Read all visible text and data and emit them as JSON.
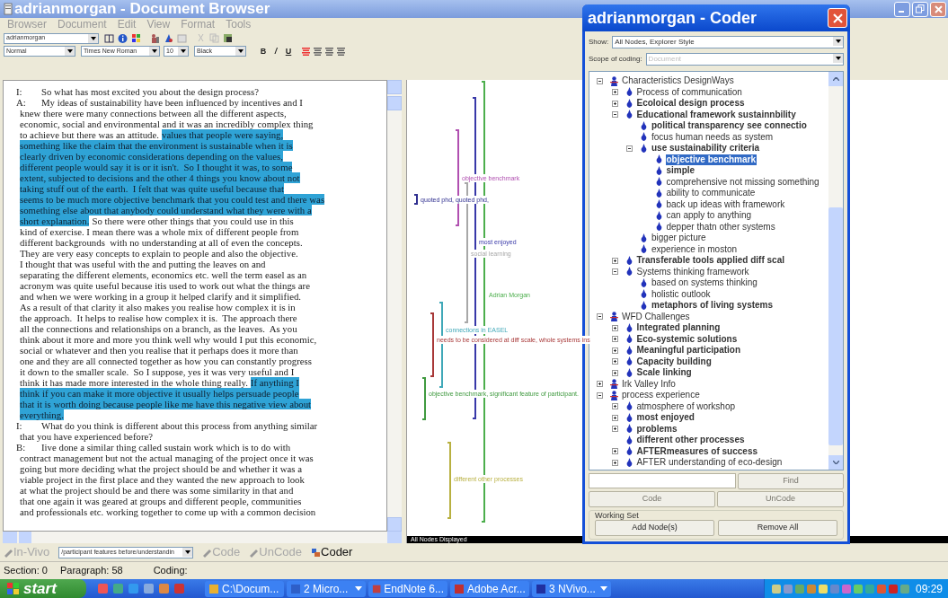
{
  "window": {
    "title": "adrianmorgan - Document Browser"
  },
  "menu": [
    "Browser",
    "Document",
    "Edit",
    "View",
    "Format",
    "Tools"
  ],
  "toolbar": {
    "user": "adrianmorgan"
  },
  "format_bar": {
    "style": "Normal",
    "font": "Times New Roman",
    "size": "10",
    "text_color": "Black",
    "buttons": [
      "B",
      "/",
      "U"
    ]
  },
  "document": {
    "lines": [
      {
        "speaker": "I:",
        "segments": [
          {
            "text": "So what has most excited you about the design process?",
            "coded": false
          }
        ]
      },
      {
        "speaker": "A:",
        "segments": [
          {
            "text": "My ideas of sustainability have been influenced by incentives and I",
            "coded": false
          }
        ]
      },
      {
        "segments": [
          {
            "text": "knew there were many connections between all the different aspects,",
            "coded": false
          }
        ]
      },
      {
        "segments": [
          {
            "text": "economic, social and environmental and it was an incredibly complex thing",
            "coded": false
          }
        ]
      },
      {
        "segments": [
          {
            "text": "to achieve but there was an attitude.",
            "coded": false
          },
          {
            "text": "values that people were saying,",
            "coded": true
          }
        ]
      },
      {
        "segments": [
          {
            "text": "something like the claim that the environment is sustainable when it is",
            "coded": true
          }
        ]
      },
      {
        "segments": [
          {
            "text": "clearly driven by economic considerations depending on the values,",
            "coded": true
          }
        ]
      },
      {
        "segments": [
          {
            "text": "different people would say it is or it isn't.  So I thought it was, to some",
            "coded": true
          }
        ]
      },
      {
        "segments": [
          {
            "text": "extent, subjected to decisions and the other 4 things you know about not",
            "coded": true
          }
        ]
      },
      {
        "segments": [
          {
            "text": "taking stuff out of the earth.  I felt that was quite useful because that",
            "coded": true
          }
        ]
      },
      {
        "segments": [
          {
            "text": "seems to be much more objective benchmark that you could test and there was",
            "coded": true
          }
        ]
      },
      {
        "segments": [
          {
            "text": "something else about that anybody could understand what they were with a",
            "coded": true
          }
        ]
      },
      {
        "segments": [
          {
            "text": "short explanation.",
            "coded": true
          },
          {
            "text": "So there were other things that you could use in this",
            "coded": false
          }
        ]
      },
      {
        "segments": [
          {
            "text": "kind of exercise. I mean there was a whole mix of different people from",
            "coded": false
          }
        ]
      },
      {
        "segments": [
          {
            "text": "different backgrounds  with no understanding at all of even the concepts.",
            "coded": false
          }
        ]
      },
      {
        "segments": [
          {
            "text": "They are very easy concepts to explain to people and also the objective.",
            "coded": false
          }
        ]
      },
      {
        "segments": [
          {
            "text": "I thought that was useful with the and putting the leaves on and",
            "coded": false
          }
        ]
      },
      {
        "segments": [
          {
            "text": "separating the different elements, economics etc. well the term easel as an",
            "coded": false
          }
        ]
      },
      {
        "segments": [
          {
            "text": "acronym was quite useful because itis used to work out what the things are",
            "coded": false
          }
        ]
      },
      {
        "segments": [
          {
            "text": "and when we were working in a group it helped clarify and it simplified.",
            "coded": false
          }
        ]
      },
      {
        "segments": [
          {
            "text": "As a result of that clarity it also makes you realise how complex it is in",
            "coded": false
          }
        ]
      },
      {
        "segments": [
          {
            "text": "the approach.  It helps to realise how complex it is.  The approach there",
            "coded": false
          }
        ]
      },
      {
        "segments": [
          {
            "text": "all the connections and relationships on a branch, as the leaves.  As you",
            "coded": false
          }
        ]
      },
      {
        "segments": [
          {
            "text": "think about it more and more you think well why would I put this economic,",
            "coded": false
          }
        ]
      },
      {
        "segments": [
          {
            "text": "social or whatever and then you realise that it perhaps does it more than",
            "coded": false
          }
        ]
      },
      {
        "segments": [
          {
            "text": "one and they are all connected together as how you can constantly progress",
            "coded": false
          }
        ]
      },
      {
        "segments": [
          {
            "text": "it down to the smaller scale.  So I suppose, yes it was very useful and I",
            "coded": false
          }
        ]
      },
      {
        "segments": [
          {
            "text": "think it has made more interested in the whole thing really.",
            "coded": false
          },
          {
            "text": "If anything I",
            "coded": true
          }
        ]
      },
      {
        "segments": [
          {
            "text": "think if you can make it more objective it usually helps persuade people",
            "coded": true
          }
        ]
      },
      {
        "segments": [
          {
            "text": "that it is worth doing because people like me have this negative view about",
            "coded": true
          }
        ]
      },
      {
        "segments": [
          {
            "text": "everything.",
            "coded": true
          }
        ]
      },
      {
        "speaker": "I:",
        "segments": [
          {
            "text": "What do you think is different about this process from anything similar",
            "coded": false
          }
        ]
      },
      {
        "segments": [
          {
            "text": "that you have experienced before?",
            "coded": false
          }
        ]
      },
      {
        "speaker": "B:",
        "segments": [
          {
            "text": "Iive done a similar thing called sustain work which is to do with",
            "coded": false
          }
        ]
      },
      {
        "segments": [
          {
            "text": "contract management but not the actual managing of the project once it was",
            "coded": false
          }
        ]
      },
      {
        "segments": [
          {
            "text": "going but more deciding what the project should be and whether it was a",
            "coded": false
          }
        ]
      },
      {
        "segments": [
          {
            "text": "viable project in the first place and they wanted the new approach to look",
            "coded": false
          }
        ]
      },
      {
        "segments": [
          {
            "text": "at what the project should be and there was some similarity in that and",
            "coded": false
          }
        ]
      },
      {
        "segments": [
          {
            "text": "that one again it was geared at groups and different people, communities",
            "coded": false
          }
        ]
      },
      {
        "segments": [
          {
            "text": "and professionals etc. working together to come up with a common decision",
            "coded": false
          }
        ]
      }
    ]
  },
  "stripes": {
    "items": [
      {
        "label": "objective benchmark",
        "color": "#b050b0"
      },
      {
        "label": "quoted phd, quoted phd,",
        "color": "#303090"
      },
      {
        "label": "most enjoyed",
        "color": "#3838a8"
      },
      {
        "label": "social learning",
        "color": "#a8a8a8"
      },
      {
        "label": "Adrian Morgan",
        "color": "#4cae4c"
      },
      {
        "label": "connections in EASEL",
        "color": "#40a8b8"
      },
      {
        "label": "needs to be considered at diff scale, whole systems ins",
        "color": "#a83838"
      },
      {
        "label": "objective benchmark, significant feature of participant.",
        "color": "#409a40"
      },
      {
        "label": "different other processes",
        "color": "#b8b040"
      }
    ],
    "status": "All Nodes Displayed"
  },
  "coder": {
    "title": "adrianmorgan - Coder",
    "show_label": "Show:",
    "show_value": "All Nodes, Explorer Style",
    "scope_label": "Scope of coding:",
    "scope_value": "Document",
    "tree": [
      {
        "label": "Characteristics DesignWays",
        "bold": false,
        "selected": false,
        "expanded": true,
        "children": [
          {
            "label": "Process of communication",
            "bold": false,
            "selected": false,
            "expanded": false
          },
          {
            "label": "Ecoloical design process",
            "bold": true,
            "selected": false,
            "expanded": false
          },
          {
            "label": "Educational framework sustainnbility",
            "bold": true,
            "selected": false,
            "expanded": true,
            "children": [
              {
                "label": "political transparency see connectio",
                "bold": true,
                "selected": false
              },
              {
                "label": "focus human needs as system",
                "bold": false,
                "selected": false
              },
              {
                "label": "use sustainability criteria",
                "bold": true,
                "selected": false,
                "expanded": true,
                "children": [
                  {
                    "label": "objective benchmark",
                    "bold": true,
                    "selected": true
                  },
                  {
                    "label": "simple",
                    "bold": true,
                    "selected": false
                  },
                  {
                    "label": "comprehensive not missing something",
                    "bold": false,
                    "selected": false
                  },
                  {
                    "label": "ability to communicate",
                    "bold": false,
                    "selected": false
                  },
                  {
                    "label": "back up ideas with framework",
                    "bold": false,
                    "selected": false
                  },
                  {
                    "label": "can apply to anything",
                    "bold": false,
                    "selected": false
                  },
                  {
                    "label": "depper thatn other systems",
                    "bold": false,
                    "selected": false
                  }
                ]
              },
              {
                "label": "bigger picture",
                "bold": false,
                "selected": false
              },
              {
                "label": "experience in moston",
                "bold": false,
                "selected": false
              }
            ]
          },
          {
            "label": "Transferable tools applied diff scal",
            "bold": true,
            "selected": false,
            "expanded": false
          },
          {
            "label": "Systems thinking framework",
            "bold": false,
            "selected": false,
            "expanded": true,
            "children": [
              {
                "label": "based on systems thinking",
                "bold": false,
                "selected": false
              },
              {
                "label": "holistic outlook",
                "bold": false,
                "selected": false
              },
              {
                "label": "metaphors of living systems",
                "bold": true,
                "selected": false
              }
            ]
          }
        ]
      },
      {
        "label": "WFD Challenges",
        "bold": false,
        "selected": false,
        "expanded": true,
        "children": [
          {
            "label": "Integrated planning",
            "bold": true,
            "selected": false,
            "expanded": false
          },
          {
            "label": "Eco-systemic solutions",
            "bold": true,
            "selected": false,
            "expanded": false
          },
          {
            "label": "Meaningful participation",
            "bold": true,
            "selected": false,
            "expanded": false
          },
          {
            "label": "Capacity building",
            "bold": true,
            "selected": false,
            "expanded": false
          },
          {
            "label": "Scale linking",
            "bold": true,
            "selected": false,
            "expanded": false
          }
        ]
      },
      {
        "label": "Irk Valley Info",
        "bold": false,
        "selected": false,
        "expanded": false
      },
      {
        "label": "process experience",
        "bold": false,
        "selected": false,
        "expanded": true,
        "children": [
          {
            "label": "atmosphere of workshop",
            "bold": false,
            "selected": false,
            "expanded": false
          },
          {
            "label": "most enjoyed",
            "bold": true,
            "selected": false,
            "expanded": false
          },
          {
            "label": "problems",
            "bold": true,
            "selected": false,
            "expanded": false
          },
          {
            "label": "different other processes",
            "bold": true,
            "selected": false
          },
          {
            "label": "AFTERmeasures of success",
            "bold": true,
            "selected": false,
            "expanded": false
          },
          {
            "label": "AFTER understanding of eco-design",
            "bold": false,
            "selected": false,
            "expanded": false
          }
        ]
      }
    ],
    "find_button": {
      "label": "Find",
      "disabled": true
    },
    "code_buttons": [
      {
        "label": "Code",
        "disabled": true
      },
      {
        "label": "UnCode",
        "disabled": true
      }
    ],
    "working_set": {
      "label": "Working Set",
      "buttons": [
        "Add Node(s)",
        "Remove All"
      ]
    }
  },
  "coding_bar": {
    "items": [
      {
        "kind": "button",
        "label": "In-Vivo",
        "disabled": true
      },
      {
        "kind": "select",
        "label": "/participant features before/understandin"
      },
      {
        "kind": "button",
        "label": "Code",
        "disabled": true
      },
      {
        "kind": "button",
        "label": "UnCode",
        "disabled": true
      },
      {
        "kind": "button",
        "label": "Coder",
        "disabled": false
      }
    ]
  },
  "status_bar": [
    "Section: 0",
    "Paragraph: 58",
    "Coding:"
  ],
  "taskbar": {
    "start": "start",
    "tasks": [
      {
        "label": "C:\\Docum...",
        "grouped": false,
        "selected": false
      },
      {
        "label": "2 Micro...",
        "grouped": true,
        "selected": false
      },
      {
        "label": "EndNote 6...",
        "grouped": false,
        "selected": false
      },
      {
        "label": "Adobe Acr...",
        "grouped": false,
        "selected": false
      },
      {
        "label": "3 NVivo...",
        "grouped": true,
        "selected": false
      }
    ],
    "clock": "09:29"
  }
}
